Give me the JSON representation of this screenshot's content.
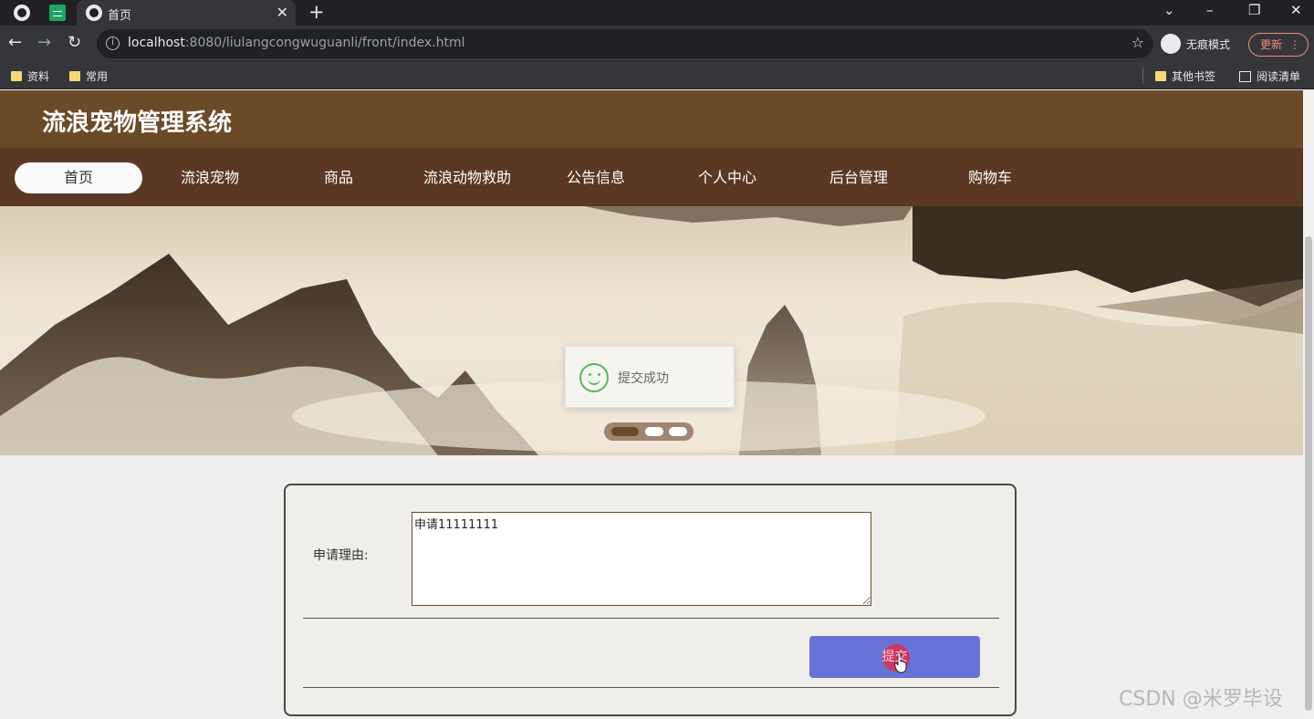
{
  "browser": {
    "tab_title": "首页",
    "tab_close": "✕",
    "new_tab": "+",
    "url_host": "localhost",
    "url_rest": ":8080/liulangcongwuguanli/front/index.html",
    "incognito_label": "无痕模式",
    "update_label": "更新",
    "bookmarks": [
      "资料",
      "常用"
    ],
    "other_bookmarks": "其他书签",
    "reading_list": "阅读清单"
  },
  "site": {
    "title": "流浪宠物管理系统",
    "nav": [
      {
        "label": "首页",
        "active": true
      },
      {
        "label": "流浪宠物"
      },
      {
        "label": "商品"
      },
      {
        "label": "流浪动物救助"
      },
      {
        "label": "公告信息"
      },
      {
        "label": "个人中心"
      },
      {
        "label": "后台管理"
      },
      {
        "label": "购物车"
      }
    ]
  },
  "banner": {
    "toast_text": "提交成功",
    "slides": 3,
    "active_slide": 1
  },
  "form": {
    "reason_label": "申请理由:",
    "reason_value": "申请11111111",
    "submit_label": "提交"
  },
  "watermark": "CSDN @米罗毕设",
  "colors": {
    "header_bg": "#6b4a28",
    "nav_bg": "#5b3823",
    "submit_bg": "#6773d6",
    "toast_icon": "#5cb85c"
  }
}
